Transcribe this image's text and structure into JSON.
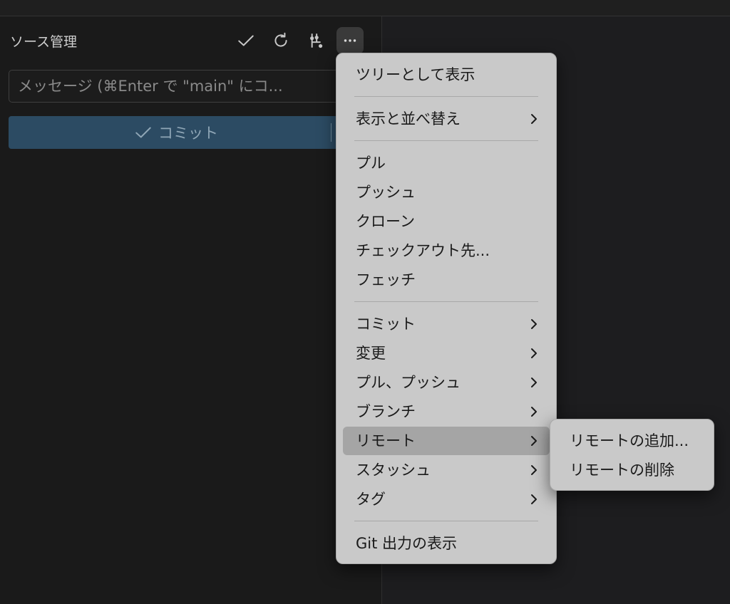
{
  "source_control": {
    "title": "ソース管理",
    "toolbar": {
      "commit_icon": "check-icon",
      "refresh_icon": "refresh-icon",
      "graph_icon": "git-graph-icon",
      "more_icon": "ellipsis-icon"
    },
    "message_placeholder": "メッセージ (⌘Enter で \"main\" にコ...",
    "commit_button_label": "コミット"
  },
  "context_menu": {
    "items": [
      {
        "label": "ツリーとして表示",
        "submenu": false
      },
      {
        "label": "表示と並べ替え",
        "submenu": true
      },
      {
        "label": "プル",
        "submenu": false
      },
      {
        "label": "プッシュ",
        "submenu": false
      },
      {
        "label": "クローン",
        "submenu": false
      },
      {
        "label": "チェックアウト先...",
        "submenu": false
      },
      {
        "label": "フェッチ",
        "submenu": false
      },
      {
        "label": "コミット",
        "submenu": true
      },
      {
        "label": "変更",
        "submenu": true
      },
      {
        "label": "プル、プッシュ",
        "submenu": true
      },
      {
        "label": "ブランチ",
        "submenu": true
      },
      {
        "label": "リモート",
        "submenu": true,
        "highlighted": true
      },
      {
        "label": "スタッシュ",
        "submenu": true
      },
      {
        "label": "タグ",
        "submenu": true
      },
      {
        "label": "Git 出力の表示",
        "submenu": false
      }
    ]
  },
  "remote_submenu": {
    "items": [
      {
        "label": "リモートの追加..."
      },
      {
        "label": "リモートの削除"
      }
    ]
  },
  "colors": {
    "sidebar_bg": "#1a1a1a",
    "commit_button_bg": "#2c4b63",
    "menu_bg": "#c9c9c9",
    "menu_highlight": "#a5a5a5"
  }
}
